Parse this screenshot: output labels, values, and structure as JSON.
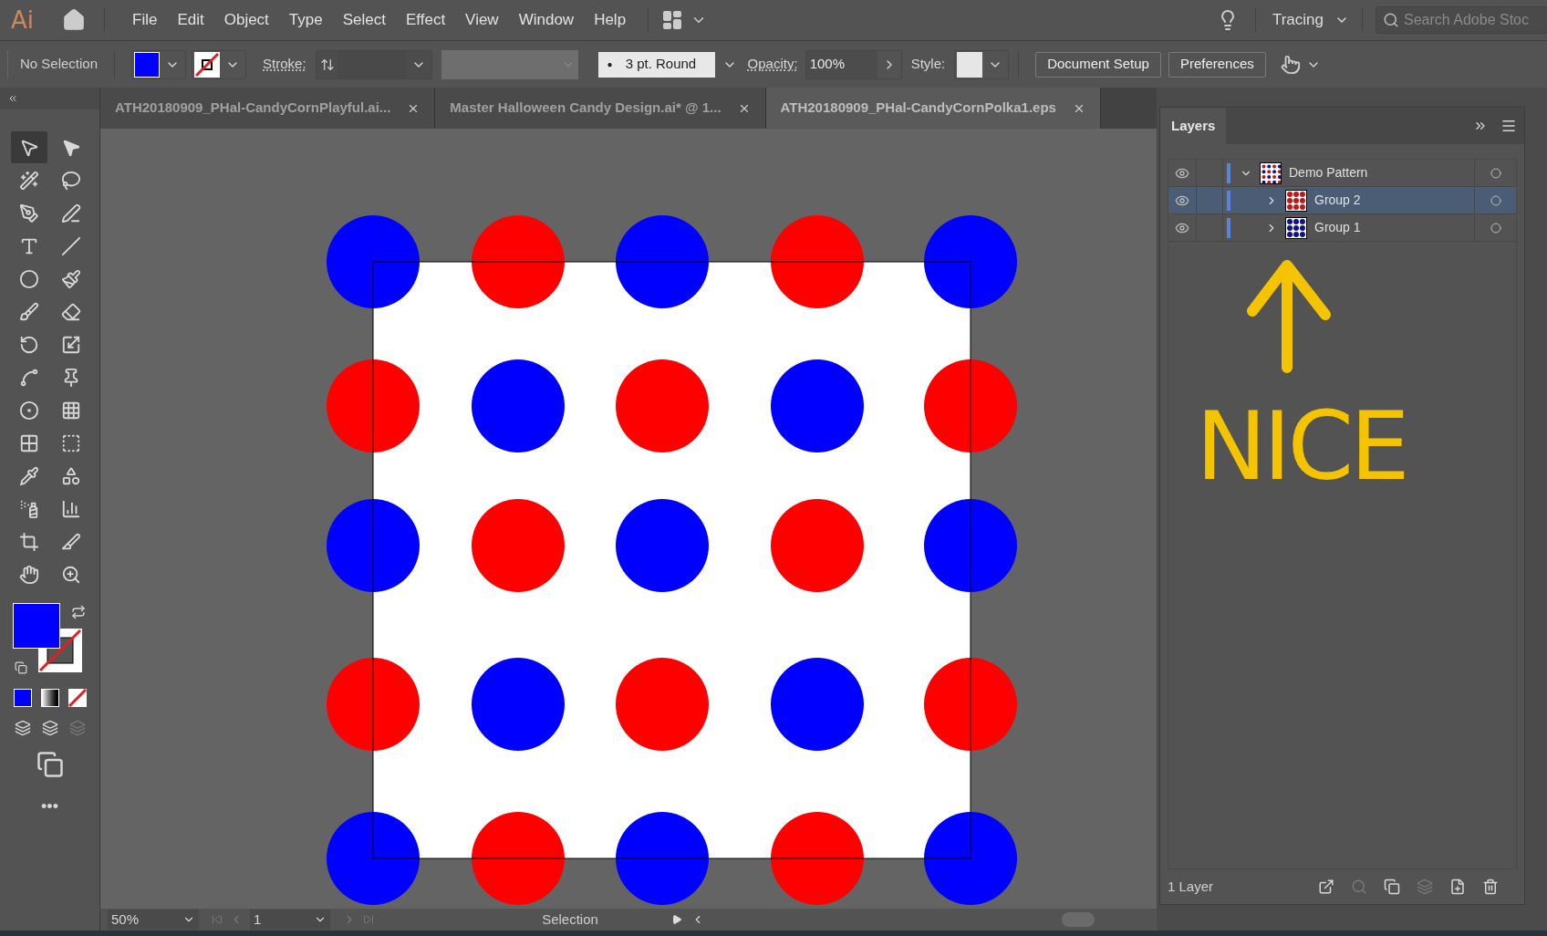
{
  "app": {
    "logo": "Ai"
  },
  "menu": [
    "File",
    "Edit",
    "Object",
    "Type",
    "Select",
    "Effect",
    "View",
    "Window",
    "Help"
  ],
  "workspace": "Tracing",
  "search": {
    "placeholder": "Search Adobe Stoc"
  },
  "control_bar": {
    "selection": "No Selection",
    "fill": {
      "color": "#0000ff"
    },
    "stroke_label": "Stroke:",
    "brush": "3 pt. Round",
    "brush_dot": "●",
    "opacity_label": "Opacity:",
    "opacity": "100%",
    "style_label": "Style:",
    "buttons": [
      "Document Setup",
      "Preferences"
    ]
  },
  "tabs": [
    {
      "label": "ATH20180909_PHal-CandyCornPlayful.ai...",
      "selected": false
    },
    {
      "label": "Master Halloween Candy Design.ai* @ 1...",
      "selected": false
    },
    {
      "label": "ATH20180909_PHal-CandyCornPolka1.eps",
      "selected": true
    }
  ],
  "toolbar": {
    "tools": [
      {
        "selected": true
      },
      {
        "selected": false
      },
      {
        "selected": false
      },
      {
        "selected": false
      },
      {
        "selected": false
      },
      {
        "selected": false
      },
      {
        "selected": false
      },
      {
        "selected": false
      },
      {
        "selected": false
      },
      {
        "selected": false
      },
      {
        "selected": false
      },
      {
        "selected": false
      },
      {
        "selected": false
      },
      {
        "selected": false
      },
      {
        "selected": false
      },
      {
        "selected": false
      },
      {
        "selected": false
      },
      {
        "selected": false
      },
      {
        "selected": false
      },
      {
        "selected": false
      },
      {
        "selected": false
      },
      {
        "selected": false
      },
      {
        "selected": false
      },
      {
        "selected": false
      },
      {
        "selected": false
      },
      {
        "selected": false
      }
    ],
    "fill": {
      "color": "#0000ff"
    },
    "more": "•••"
  },
  "artwork": {
    "circles": [
      {
        "color": "#0000ff"
      },
      {
        "color": "#ff0000"
      },
      {
        "color": "#0000ff"
      },
      {
        "color": "#ff0000"
      },
      {
        "color": "#0000ff"
      },
      {
        "color": "#ff0000"
      },
      {
        "color": "#0000ff"
      },
      {
        "color": "#ff0000"
      },
      {
        "color": "#0000ff"
      },
      {
        "color": "#ff0000"
      },
      {
        "color": "#0000ff"
      },
      {
        "color": "#ff0000"
      },
      {
        "color": "#0000ff"
      },
      {
        "color": "#ff0000"
      },
      {
        "color": "#0000ff"
      },
      {
        "color": "#ff0000"
      },
      {
        "color": "#0000ff"
      },
      {
        "color": "#ff0000"
      },
      {
        "color": "#0000ff"
      },
      {
        "color": "#ff0000"
      },
      {
        "color": "#0000ff"
      },
      {
        "color": "#ff0000"
      },
      {
        "color": "#0000ff"
      },
      {
        "color": "#ff0000"
      },
      {
        "color": "#0000ff"
      }
    ]
  },
  "layers_panel": {
    "title": "Layers",
    "layers": [
      {
        "name": "Demo Pattern",
        "visible": true,
        "expanded": true,
        "selected": false,
        "children": [
          {
            "name": "Group 2",
            "visible": true,
            "expanded": false,
            "selected": true,
            "color": "#c01818"
          },
          {
            "name": "Group 1",
            "visible": true,
            "expanded": false,
            "selected": false,
            "color": "#10108a"
          }
        ]
      }
    ],
    "annotation": "NICE",
    "footer": "1 Layer"
  },
  "status_bar": {
    "zoom": "50%",
    "artboard": "1",
    "tool": "Selection"
  }
}
